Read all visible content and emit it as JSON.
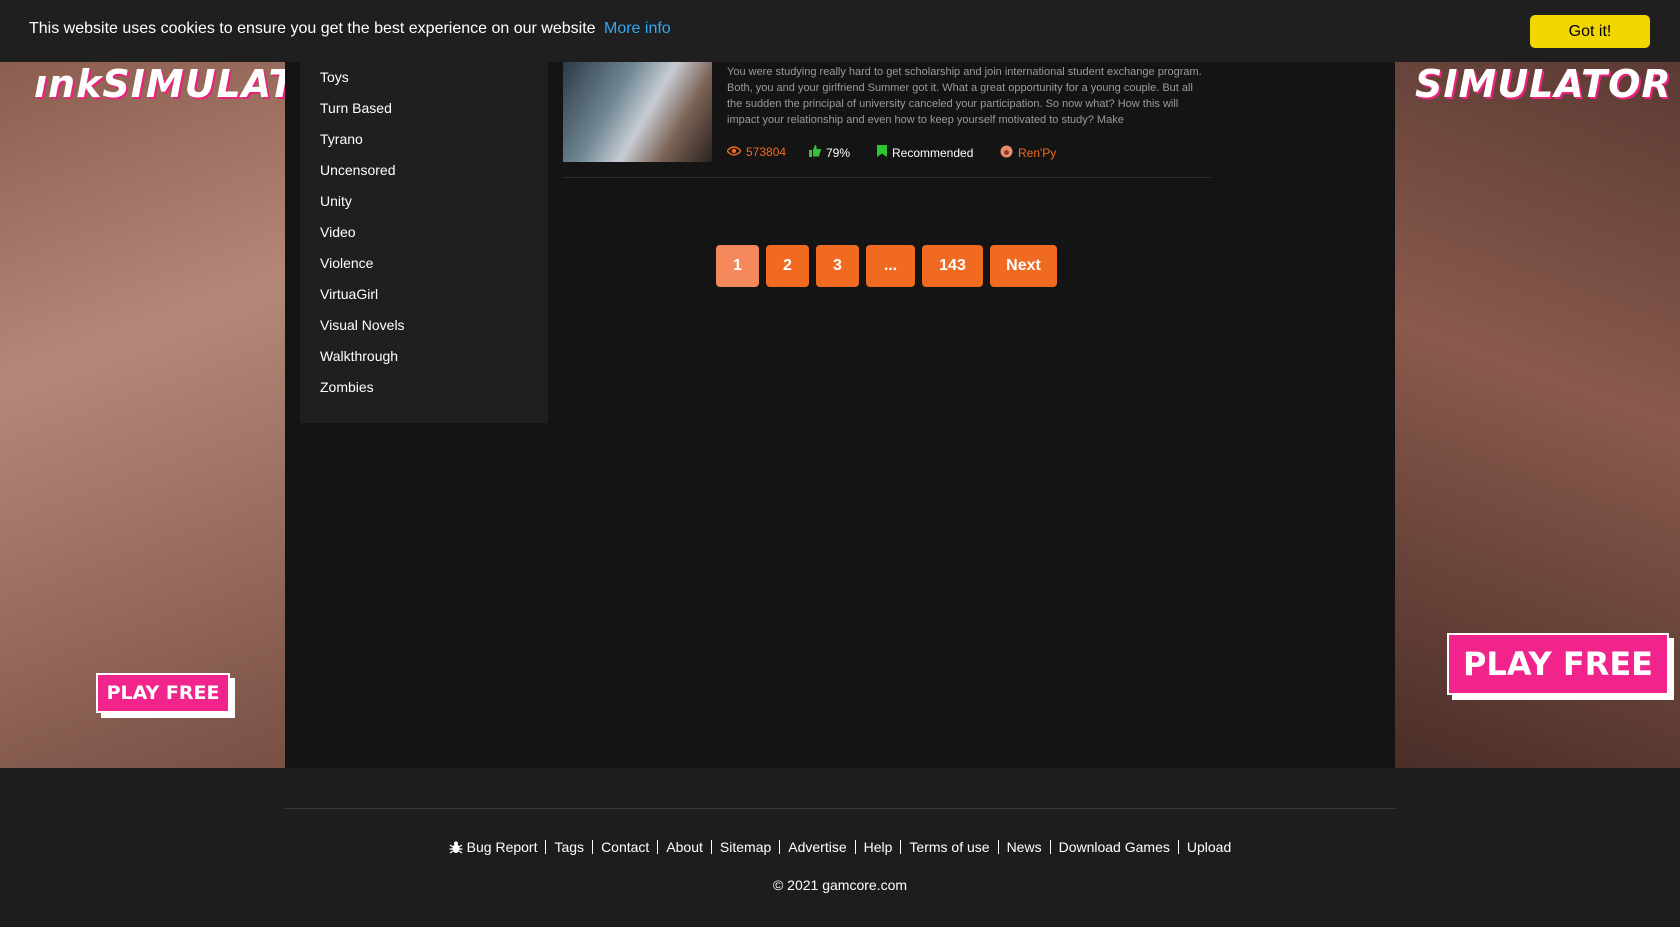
{
  "cookie_bar": {
    "message": "This website uses cookies to ensure you get the best experience on our website",
    "link_label": "More info",
    "accept_label": "Got it!"
  },
  "ads": {
    "left": {
      "brand": "ınkSIMULATOR",
      "cta": "PLAY FREE"
    },
    "right": {
      "brand": "SIMULATOR",
      "cta": "PLAY FREE"
    }
  },
  "categories": [
    "Toys",
    "Turn Based",
    "Tyrano",
    "Uncensored",
    "Unity",
    "Video",
    "Violence",
    "VirtuaGirl",
    "Visual Novels",
    "Walkthrough",
    "Zombies"
  ],
  "game": {
    "description": "You were studying really hard to get scholarship and join international student exchange program. Both, you and your girlfriend Summer got it. What a great opportunity for a young couple. But all the sudden the principal of university canceled your participation. So now what? How this will impact your relationship and even how to keep yourself motivated to study? Make",
    "views": "573804",
    "rating": "79%",
    "status": "Recommended",
    "engine": "Ren'Py",
    "icons": {
      "views": "eye-icon",
      "rating": "thumbs-up-icon",
      "status": "bookmark-icon",
      "engine": "renpy-icon"
    },
    "colors": {
      "views": "#f06a22",
      "rating_icon": "#3cbf3c",
      "status_icon": "#2fc72f"
    }
  },
  "pagination": {
    "pages": [
      "1",
      "2",
      "3",
      "...",
      "143"
    ],
    "next_label": "Next",
    "current": "1"
  },
  "footer": {
    "bug_report": "Bug Report",
    "links": [
      "Tags",
      "Contact",
      "About",
      "Sitemap",
      "Advertise",
      "Help",
      "Terms of use",
      "News",
      "Download Games",
      "Upload"
    ],
    "copyright": "© 2021 gamcore.com"
  },
  "colors": {
    "accent": "#f06a22",
    "cookie_button": "#f1d600",
    "link": "#31a8f0",
    "background": "#141414"
  }
}
